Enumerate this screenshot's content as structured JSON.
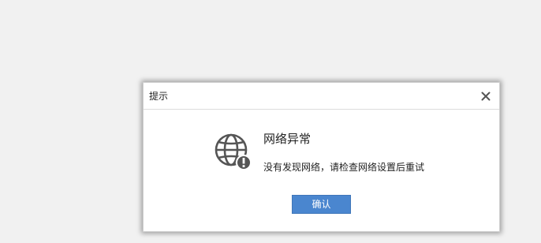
{
  "dialog": {
    "title": "提示",
    "close_icon": "close-icon",
    "icon": "globe-warning-icon",
    "heading": "网络异常",
    "message": "没有发现网络，请检查网络设置后重试",
    "ok_label": "确认"
  },
  "colors": {
    "button_bg": "#4a86cf",
    "icon": "#555555",
    "background": "#f1f1f1"
  }
}
